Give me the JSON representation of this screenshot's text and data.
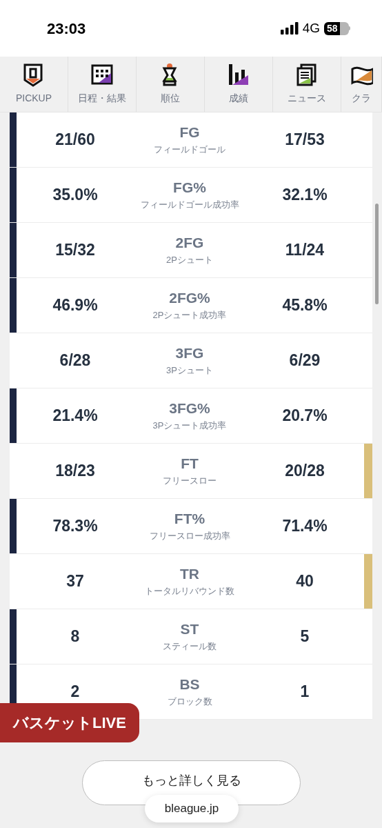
{
  "status_bar": {
    "time": "23:03",
    "network": "4G",
    "battery": "58"
  },
  "nav": [
    {
      "label": "PICKUP"
    },
    {
      "label": "日程・結果"
    },
    {
      "label": "順位"
    },
    {
      "label": "成績"
    },
    {
      "label": "ニュース"
    },
    {
      "label": "クラ"
    }
  ],
  "stats": [
    {
      "home": "21/60",
      "label": "FG",
      "sub": "フィールドゴール",
      "away": "17/53",
      "home_leads": true,
      "away_leads": false
    },
    {
      "home": "35.0%",
      "label": "FG%",
      "sub": "フィールドゴール成功率",
      "away": "32.1%",
      "home_leads": true,
      "away_leads": false
    },
    {
      "home": "15/32",
      "label": "2FG",
      "sub": "2Pシュート",
      "away": "11/24",
      "home_leads": true,
      "away_leads": false
    },
    {
      "home": "46.9%",
      "label": "2FG%",
      "sub": "2Pシュート成功率",
      "away": "45.8%",
      "home_leads": true,
      "away_leads": false
    },
    {
      "home": "6/28",
      "label": "3FG",
      "sub": "3Pシュート",
      "away": "6/29",
      "home_leads": false,
      "away_leads": false
    },
    {
      "home": "21.4%",
      "label": "3FG%",
      "sub": "3Pシュート成功率",
      "away": "20.7%",
      "home_leads": true,
      "away_leads": false
    },
    {
      "home": "18/23",
      "label": "FT",
      "sub": "フリースロー",
      "away": "20/28",
      "home_leads": false,
      "away_leads": true
    },
    {
      "home": "78.3%",
      "label": "FT%",
      "sub": "フリースロー成功率",
      "away": "71.4%",
      "home_leads": true,
      "away_leads": false
    },
    {
      "home": "37",
      "label": "TR",
      "sub": "トータルリバウンド数",
      "away": "40",
      "home_leads": false,
      "away_leads": true
    },
    {
      "home": "8",
      "label": "ST",
      "sub": "スティール数",
      "away": "5",
      "home_leads": true,
      "away_leads": false
    },
    {
      "home": "2",
      "label": "BS",
      "sub": "ブロック数",
      "away": "1",
      "home_leads": true,
      "away_leads": false
    }
  ],
  "live_button": "バスケットLIVE",
  "more_button": "もっと詳しく見る",
  "url": "bleague.jp"
}
